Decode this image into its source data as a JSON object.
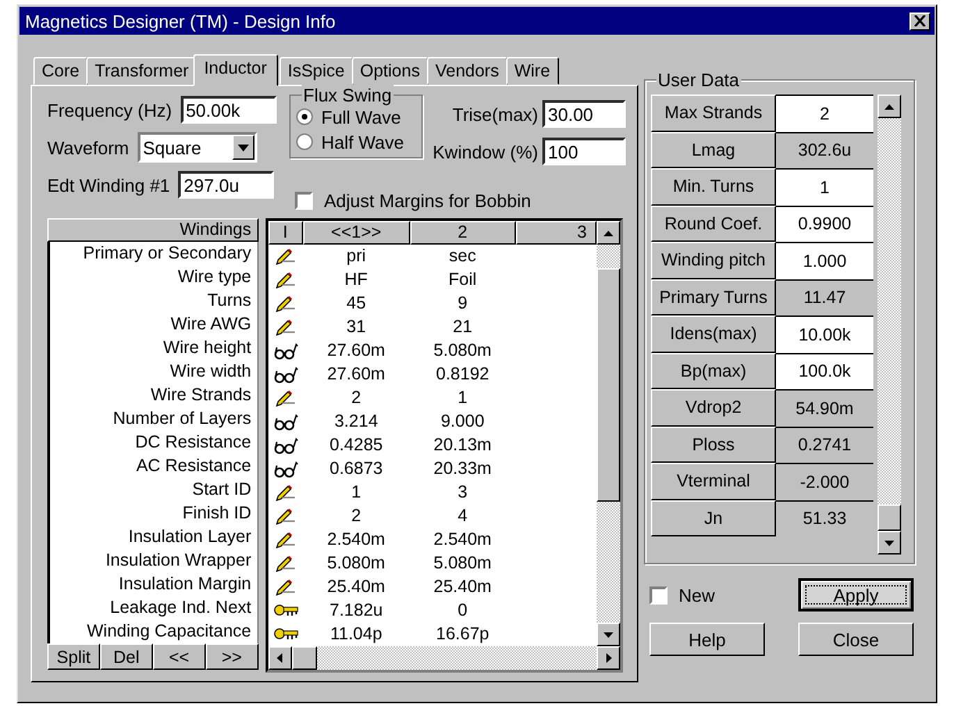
{
  "window": {
    "title": "Magnetics Designer (TM) - Design Info"
  },
  "tabs": [
    {
      "label": "Core",
      "selected": false
    },
    {
      "label": "Transformer",
      "selected": false
    },
    {
      "label": "Inductor",
      "selected": true
    },
    {
      "label": "IsSpice",
      "selected": false
    },
    {
      "label": "Options",
      "selected": false
    },
    {
      "label": "Vendors",
      "selected": false
    },
    {
      "label": "Wire",
      "selected": false
    }
  ],
  "frequency": {
    "label": "Frequency (Hz)",
    "value": "50.00k"
  },
  "waveform": {
    "label": "Waveform",
    "value": "Square"
  },
  "edt_winding": {
    "label": "Edt Winding #1",
    "value": "297.0u"
  },
  "flux_swing": {
    "title": "Flux Swing",
    "options": [
      {
        "label": "Full Wave",
        "selected": true
      },
      {
        "label": "Half Wave",
        "selected": false
      }
    ]
  },
  "trise": {
    "label": "Trise(max)",
    "value": "30.00"
  },
  "kwindow": {
    "label": "Kwindow (%)",
    "value": "100"
  },
  "adjust_margins": {
    "label": "Adjust Margins for Bobbin",
    "checked": false
  },
  "windings": {
    "header": "Windings",
    "columns": [
      "I",
      "<<1>>",
      "2",
      "3"
    ],
    "rows": [
      {
        "label": "Primary or Secondary",
        "kind": "edit",
        "values": [
          "pri",
          "sec"
        ]
      },
      {
        "label": "Wire type",
        "kind": "edit",
        "values": [
          "HF",
          "Foil"
        ]
      },
      {
        "label": "Turns",
        "kind": "edit",
        "values": [
          "45",
          "9"
        ]
      },
      {
        "label": "Wire AWG",
        "kind": "edit",
        "values": [
          "31",
          "21"
        ]
      },
      {
        "label": "Wire height",
        "kind": "view",
        "values": [
          "27.60m",
          "5.080m"
        ]
      },
      {
        "label": "Wire width",
        "kind": "view",
        "values": [
          "27.60m",
          "0.8192"
        ]
      },
      {
        "label": "Wire Strands",
        "kind": "edit",
        "values": [
          "2",
          "1"
        ]
      },
      {
        "label": "Number of Layers",
        "kind": "view",
        "values": [
          "3.214",
          "9.000"
        ]
      },
      {
        "label": "DC Resistance",
        "kind": "view",
        "values": [
          "0.4285",
          "20.13m"
        ]
      },
      {
        "label": "AC Resistance",
        "kind": "view",
        "values": [
          "0.6873",
          "20.33m"
        ]
      },
      {
        "label": "Start ID",
        "kind": "edit",
        "values": [
          "1",
          "3"
        ]
      },
      {
        "label": "Finish ID",
        "kind": "edit",
        "values": [
          "2",
          "4"
        ]
      },
      {
        "label": "Insulation  Layer",
        "kind": "edit",
        "values": [
          "2.540m",
          "2.540m"
        ]
      },
      {
        "label": "Insulation Wrapper",
        "kind": "edit",
        "values": [
          "5.080m",
          "5.080m"
        ]
      },
      {
        "label": "Insulation Margin",
        "kind": "edit",
        "values": [
          "25.40m",
          "25.40m"
        ]
      },
      {
        "label": "Leakage Ind. Next",
        "kind": "key",
        "values": [
          "7.182u",
          "0"
        ]
      },
      {
        "label": "Winding Capacitance",
        "kind": "key",
        "values": [
          "11.04p",
          "16.67p"
        ]
      }
    ],
    "buttons": [
      "Split",
      "Del",
      "<<",
      ">>"
    ]
  },
  "user_data": {
    "title": "User Data",
    "rows": [
      {
        "label": "Max Strands",
        "value": "2",
        "editable": true
      },
      {
        "label": "Lmag",
        "value": "302.6u",
        "editable": false
      },
      {
        "label": "Min. Turns",
        "value": "1",
        "editable": true
      },
      {
        "label": "Round Coef.",
        "value": "0.9900",
        "editable": true
      },
      {
        "label": "Winding pitch",
        "value": "1.000",
        "editable": true
      },
      {
        "label": "Primary Turns",
        "value": "11.47",
        "editable": false
      },
      {
        "label": "Idens(max)",
        "value": "10.00k",
        "editable": true
      },
      {
        "label": "Bp(max)",
        "value": "100.0k",
        "editable": true
      },
      {
        "label": "Vdrop2",
        "value": "54.90m",
        "editable": false
      },
      {
        "label": "Ploss",
        "value": "0.2741",
        "editable": false
      },
      {
        "label": "Vterminal",
        "value": "-2.000",
        "editable": false
      },
      {
        "label": "Jn",
        "value": "51.33",
        "editable": false
      }
    ]
  },
  "new_checkbox": {
    "label": "New",
    "checked": false
  },
  "buttons": [
    {
      "label": "Apply",
      "focused": true
    },
    {
      "label": "Help",
      "focused": false
    },
    {
      "label": "Close",
      "focused": false
    }
  ]
}
